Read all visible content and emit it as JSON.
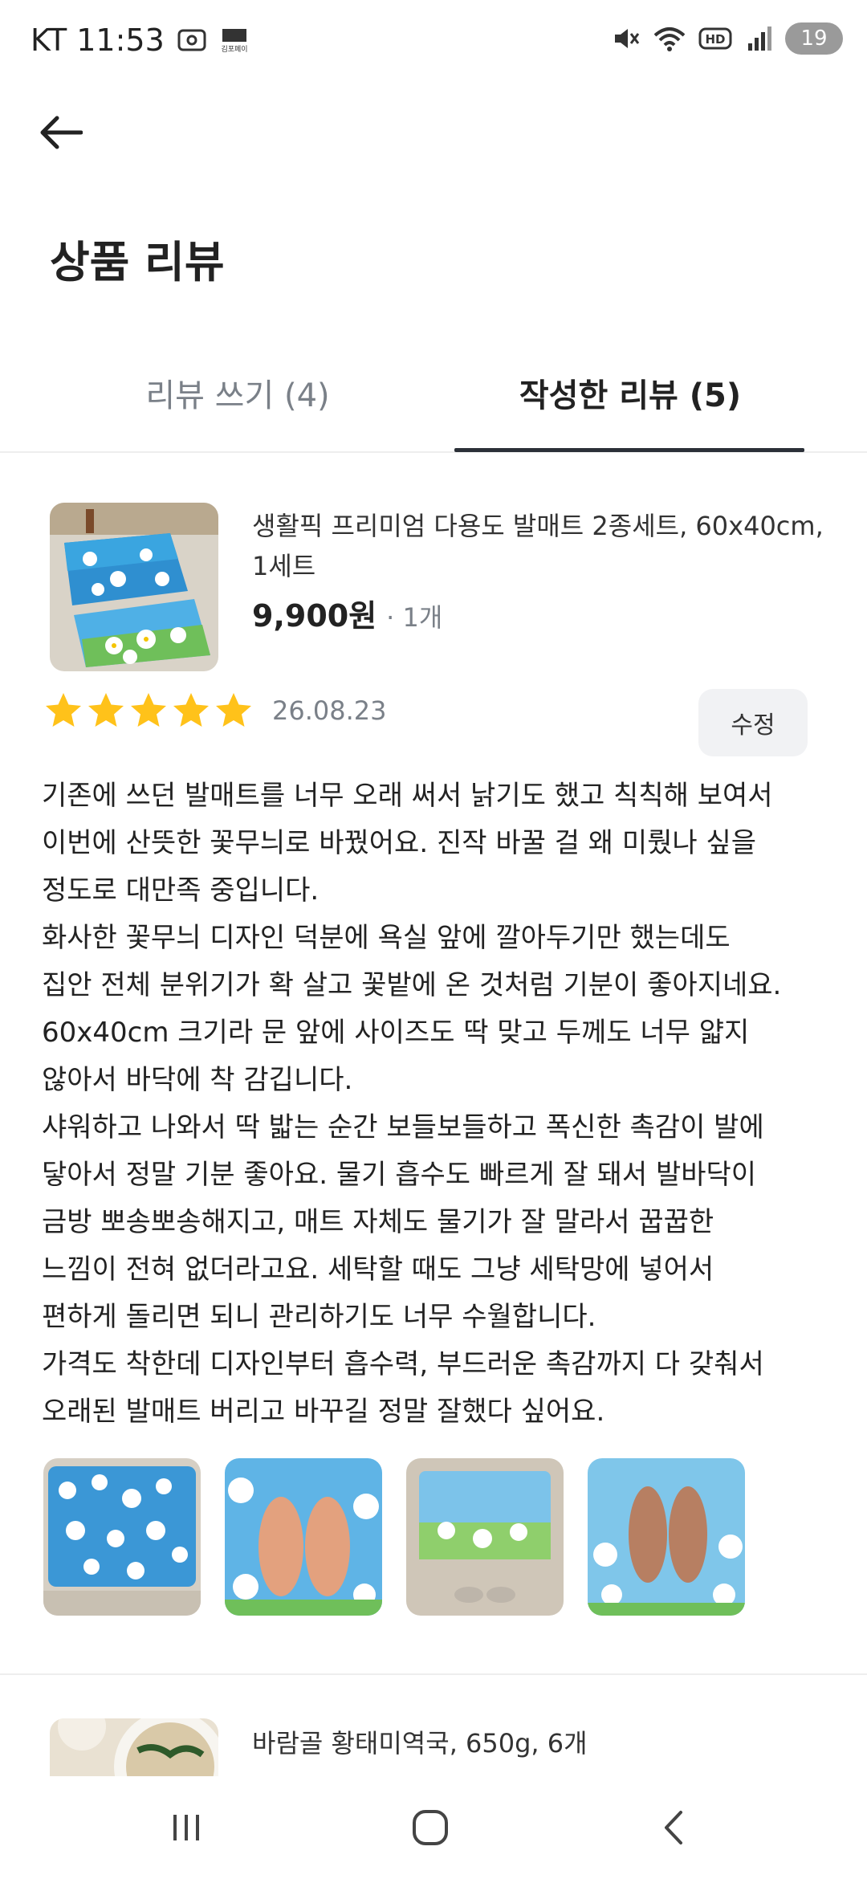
{
  "status_bar": {
    "carrier_time": "KT 11:53",
    "pay_badge": "김포페이",
    "battery": "19",
    "network_badge": "HD"
  },
  "header": {
    "title": "상품 리뷰"
  },
  "tabs": [
    {
      "label": "리뷰 쓰기 (4)",
      "active": false
    },
    {
      "label": "작성한 리뷰 (5)",
      "active": true
    }
  ],
  "reviews": [
    {
      "product_name": "생활픽 프리미엄 다용도 발매트 2종세트, 60x40cm, 1세트",
      "price": "9,900원",
      "quantity": "· 1개",
      "rating": 5,
      "date": "26.08.23",
      "edit_label": "수정",
      "text_lines": [
        "기존에 쓰던 발매트를 너무 오래 써서 낡기도 했고 칙칙해 보여서",
        "이번에 산뜻한 꽃무늬로 바꿨어요. 진작 바꿀 걸 왜 미뤘나 싶을",
        "정도로 대만족 중입니다.",
        "화사한 꽃무늬 디자인 덕분에 욕실 앞에 깔아두기만 했는데도",
        "집안 전체 분위기가 확 살고 꽃밭에 온 것처럼 기분이 좋아지네요.",
        "60x40cm 크기라 문 앞에 사이즈도 딱 맞고 두께도 너무 얇지",
        "않아서 바닥에 착 감깁니다.",
        "샤워하고 나와서 딱 밟는 순간 보들보들하고 폭신한 촉감이 발에",
        "닿아서 정말 기분 좋아요. 물기 흡수도 빠르게 잘 돼서 발바닥이",
        "금방 뽀송뽀송해지고, 매트 자체도 물기가 잘 말라서 꿉꿉한",
        "느낌이 전혀 없더라고요. 세탁할 때도 그냥 세탁망에 넣어서",
        "편하게 돌리면 되니 관리하기도 너무 수월합니다.",
        "가격도 착한데 디자인부터 흡수력, 부드러운 촉감까지 다 갖춰서",
        "오래된 발매트 버리고 바꾸길 정말 잘했다 싶어요."
      ],
      "photo_count": 4
    },
    {
      "product_name": "바람골 황태미역국, 650g, 6개"
    }
  ],
  "colors": {
    "star": "#FFC21A",
    "tab_underline": "#2b3038",
    "muted_text": "#7a8088"
  }
}
